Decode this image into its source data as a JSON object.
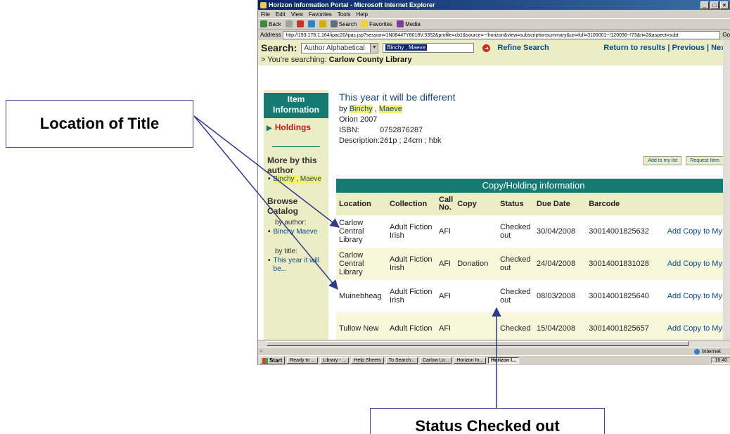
{
  "browser": {
    "title": "Horizon Information Portal - Microsoft Internet Explorer",
    "menu": [
      "File",
      "Edit",
      "View",
      "Favorites",
      "Tools",
      "Help"
    ],
    "toolbar": {
      "back": "Back",
      "search": "Search",
      "favorites": "Favorites",
      "media": "Media"
    },
    "address_label": "Address",
    "address_url": "http://193.178.1.164/ipac20/ipac.jsp?session=1N08447Y8018V.3352&profile=cb1&source=~!horizon&view=subscriptionsummary&uri=full=3100001~!120036~!73&ri=2&aspect=subt",
    "go_label": "Go",
    "status_zone": "Internet"
  },
  "search": {
    "label": "Search:",
    "type_value": "Author Alphabetical",
    "query": "Binchy , Maeve",
    "refine": "Refine Search",
    "nav": "Return to results | Previous | Next",
    "searching_prefix": "> You're searching:",
    "searching_library": "Carlow County Library"
  },
  "sidebar": {
    "item_info": "Item Information",
    "holdings": "Holdings",
    "more_by": "More by this author",
    "more_by_link": "Binchy , Maeve",
    "browse": "Browse Catalog",
    "by_author": "by author:",
    "author_link": "Binchy Maeve",
    "by_title": "by title:",
    "title_link": "This year it will be..."
  },
  "record": {
    "title": "This year it will be different",
    "by": "by",
    "author_last": "Binchy",
    "author_first": "Maeve",
    "publisher": "Orion 2007",
    "isbn_label": "ISBN:",
    "isbn": "0752876287",
    "description_label": "Description:",
    "description": "261p ; 24cm ; hbk",
    "add_list": "Add to my list",
    "request": "Request Item"
  },
  "holdings": {
    "heading": "Copy/Holding information",
    "columns": [
      "Location",
      "Collection",
      "Call No.",
      "Copy",
      "Status",
      "Due Date",
      "Barcode",
      ""
    ],
    "rows": [
      {
        "location": "Carlow Central Library",
        "collection": "Adult Fiction Irish",
        "call_no": "AFI",
        "copy": "",
        "status": "Checked out",
        "due": "30/04/2008",
        "barcode": "30014001825632",
        "action": "Add Copy to MyList"
      },
      {
        "location": "Carlow Central Library",
        "collection": "Adult Fiction Irish",
        "call_no": "AFI",
        "copy": "Donation",
        "status": "Checked out",
        "due": "24/04/2008",
        "barcode": "30014001831028",
        "action": "Add Copy to MyList"
      },
      {
        "location": "Muinebheag",
        "collection": "Adult Fiction Irish",
        "call_no": "AFI",
        "copy": "",
        "status": "Checked out",
        "due": "08/03/2008",
        "barcode": "30014001825640",
        "action": "Add Copy to MyList"
      },
      {
        "location": "Tullow New",
        "collection": "Adult Fiction",
        "call_no": "AFI",
        "copy": "",
        "status": "Checked",
        "due": "15/04/2008",
        "barcode": "30014001825657",
        "action": "Add Copy to MyList"
      }
    ]
  },
  "taskbar": {
    "start": "Start",
    "tasks": [
      "Ready to ...",
      "Library - ...",
      "Help Sheets",
      "To Search...",
      "Carlow Lo...",
      "Horizon In...",
      "Horizon I..."
    ],
    "clock": "16:40"
  },
  "callouts": {
    "title": "Location of Title",
    "status": "Status Checked out"
  },
  "colors": {
    "teal": "#157a72",
    "cream": "#ebedc5",
    "arrow": "#2e3a8a",
    "link": "#0a4a8a"
  }
}
